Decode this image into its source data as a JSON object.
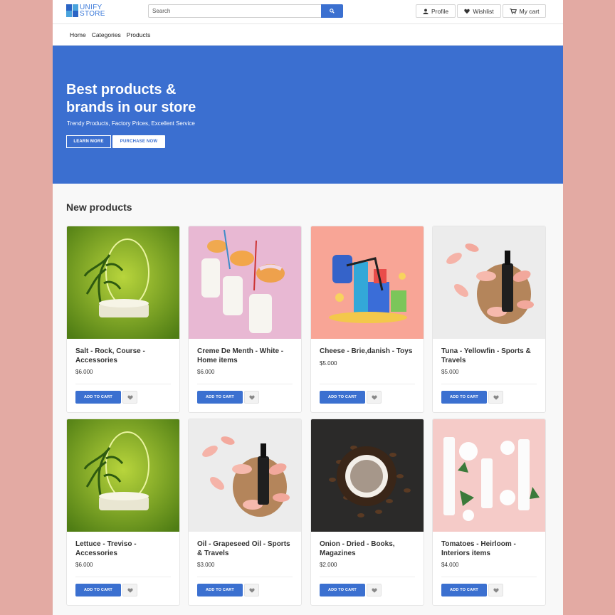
{
  "header": {
    "logo_line1": "UNIFY",
    "logo_line2": "STORE",
    "search_placeholder": "Search",
    "profile_label": "Profile",
    "wishlist_label": "Wishlist",
    "cart_label": "My cart"
  },
  "nav": [
    "Home",
    "Categories",
    "Products"
  ],
  "hero": {
    "title": "Best products & brands in our store",
    "subtitle": "Trendy Products, Factory Prices, Excellent Service",
    "learn_more": "LEARN MORE",
    "purchase_now": "PURCHASE NOW"
  },
  "section_title": "New products",
  "add_to_cart_label": "ADD TO CART",
  "products": [
    {
      "name": "Salt - Rock, Course - Accessories",
      "price": "$6.000",
      "image": "green-podium-palm"
    },
    {
      "name": "Creme De Menth - White - Home items",
      "price": "$6.000",
      "image": "milk-donuts-pink"
    },
    {
      "name": "Cheese - Brie,danish - Toys",
      "price": "$5.000",
      "image": "shopping-gifts-coral"
    },
    {
      "name": "Tuna - Yellowfin - Sports & Travels",
      "price": "$5.000",
      "image": "serum-bottle-petals"
    },
    {
      "name": "Lettuce - Treviso - Accessories",
      "price": "$6.000",
      "image": "green-podium-palm"
    },
    {
      "name": "Oil - Grapeseed Oil - Sports & Travels",
      "price": "$3.000",
      "image": "serum-bottle-petals"
    },
    {
      "name": "Onion - Dried - Books, Magazines",
      "price": "$2.000",
      "image": "coffee-beans-cup"
    },
    {
      "name": "Tomatoes - Heirloom - Interiors items",
      "price": "$4.000",
      "image": "cosmetics-pink"
    }
  ],
  "colors": {
    "brand_blue": "#3b6fd0",
    "background": "#e3aaa3"
  }
}
